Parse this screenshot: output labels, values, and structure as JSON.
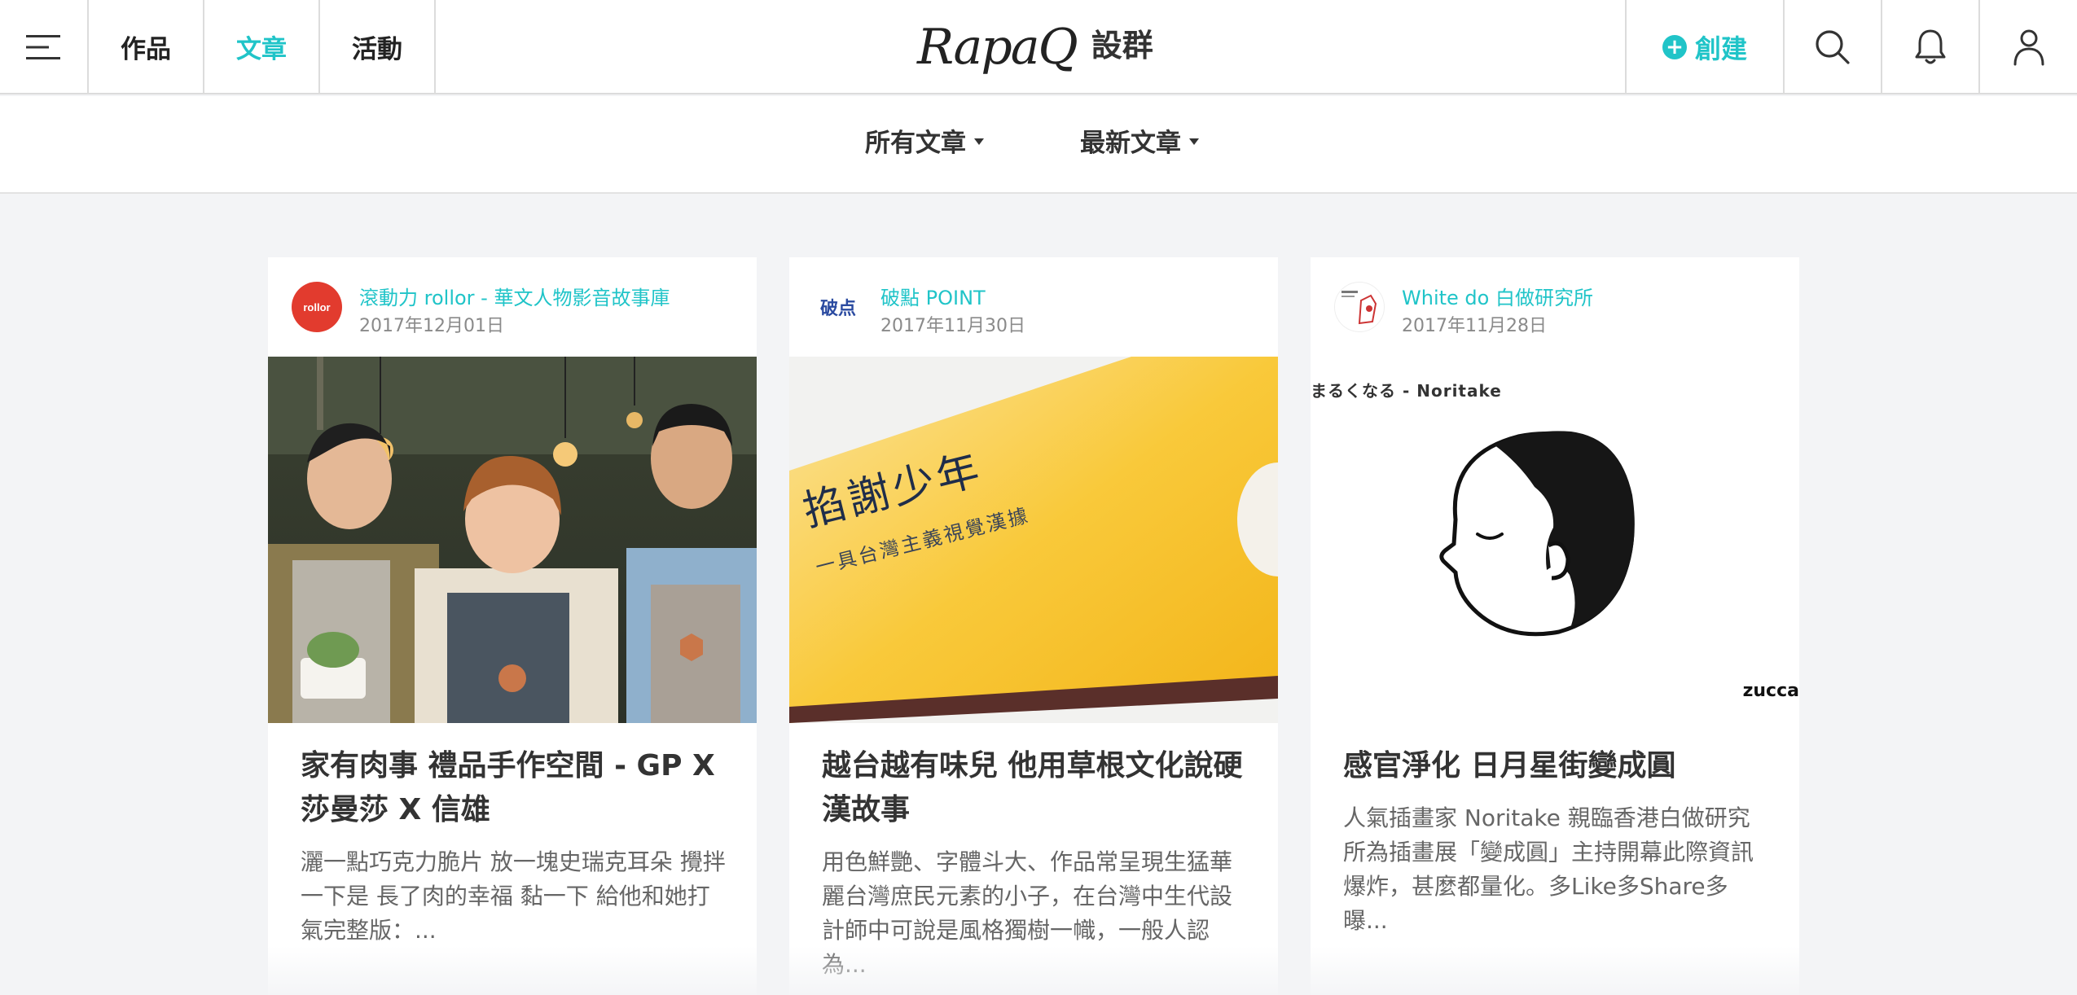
{
  "header": {
    "tabs": [
      {
        "label": "作品",
        "active": false
      },
      {
        "label": "文章",
        "active": true
      },
      {
        "label": "活動",
        "active": false
      }
    ],
    "logo_script": "RapaQ",
    "logo_text": "設群",
    "create_label": "創建",
    "icons": [
      "menu-icon",
      "search-icon",
      "bell-icon",
      "user-icon"
    ]
  },
  "filters": {
    "category": "所有文章",
    "sort": "最新文章"
  },
  "colors": {
    "accent": "#20c4c8",
    "rollor": "#e23b2e"
  },
  "articles": [
    {
      "avatar_text": "rollor",
      "author": "滾動力 rollor - 華文人物影音故事庫",
      "date": "2017年12月01日",
      "title": "家有肉事 禮品手作空間 - GP X 莎曼莎 X 信雄",
      "excerpt": "灑一點巧克力脆片 放一塊史瑞克耳朵 攪拌一下是 長了肉的幸福 黏一下 給他和她打氣完整版：..."
    },
    {
      "avatar_text": "破点",
      "author": "破點 POINT",
      "date": "2017年11月30日",
      "title": "越台越有味兒 他用草根文化說硬漢故事",
      "excerpt": "用色鮮艷、字體斗大、作品常呈現生猛華麗台灣庶民元素的小子，在台灣中生代設計師中可說是風格獨樹一幟，一般人認為...",
      "cover_text_main": "掐謝少年",
      "cover_text_sub": "一具台灣主義視覺漢據"
    },
    {
      "author": "White do 白做研究所",
      "date": "2017年11月28日",
      "title": "感官淨化 日月星街變成圓",
      "excerpt": "人氣插畫家 Noritake 親臨香港白做研究所為插畫展「變成圓」主持開幕此際資訊爆炸，甚麼都量化。多Like多Share多曝...",
      "cover_caption": "まるくなる - Noritake",
      "cover_brand": "zucca"
    }
  ]
}
